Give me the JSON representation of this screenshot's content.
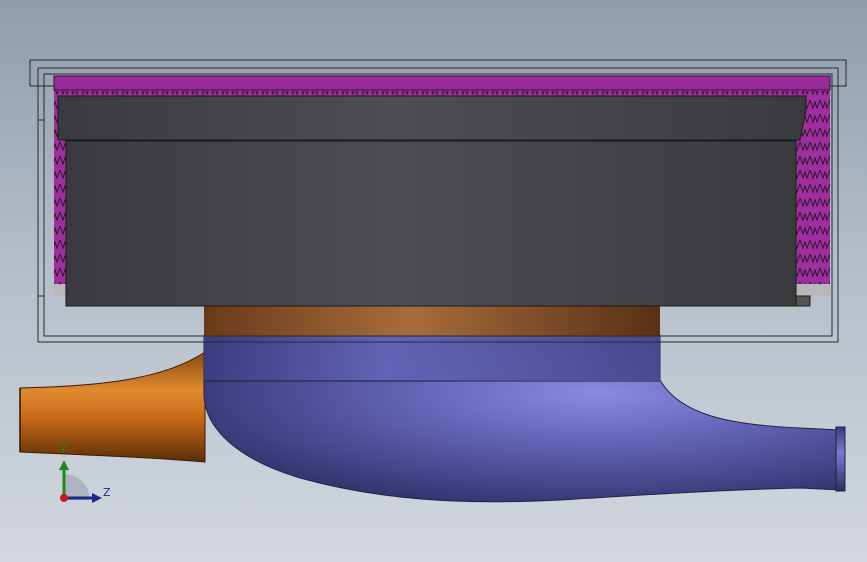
{
  "viewport": {
    "background_top": "#8f9cae",
    "background_bottom": "#d3d8df"
  },
  "model": {
    "housing_outline_color": "#2a2a2a",
    "insulation_color": "#9a2a9a",
    "magnet_block_color": "#46484c",
    "inlet_pipe_color": "#c86a18",
    "outlet_volute_color": "#5a5aa8",
    "hub_color": "#a4683a"
  },
  "triad": {
    "y_label": "Y",
    "z_label": "Z",
    "y_color": "#1a8c1a",
    "z_color": "#1a2a8c",
    "origin_color": "#c81a1a",
    "icon": "coordinate-triad-icon"
  }
}
